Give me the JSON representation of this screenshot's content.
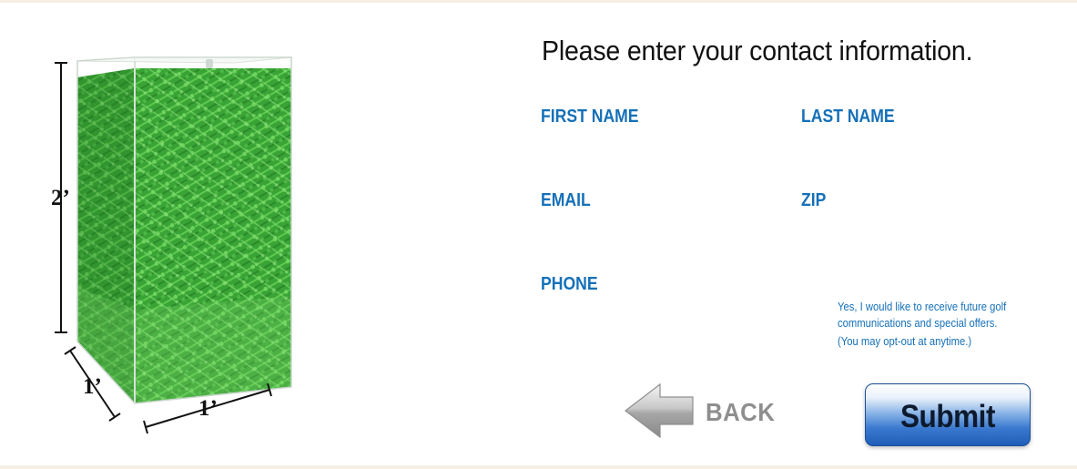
{
  "form": {
    "title": "Please enter your contact information.",
    "fields": {
      "first_name": {
        "label": "FIRST NAME",
        "value": ""
      },
      "last_name": {
        "label": "LAST NAME",
        "value": ""
      },
      "email": {
        "label": "EMAIL",
        "value": ""
      },
      "zip": {
        "label": "ZIP",
        "value": ""
      },
      "phone": {
        "label": "PHONE",
        "value": ""
      }
    },
    "optin": {
      "line1": "Yes, I would like to receive future golf communications and special offers.",
      "line2": "(You may opt-out at anytime.)"
    }
  },
  "buttons": {
    "back_label": "BACK",
    "submit_label": "Submit"
  },
  "product": {
    "height_label": "2’",
    "depth_label": "1’",
    "width_label": "1’"
  },
  "colors": {
    "label_blue": "#1570b8",
    "tee_green": "#3faa3a",
    "submit_blue": "#2a6cc8",
    "back_gray": "#8e8e8e"
  },
  "icons": {
    "back": "arrow-left-icon"
  }
}
